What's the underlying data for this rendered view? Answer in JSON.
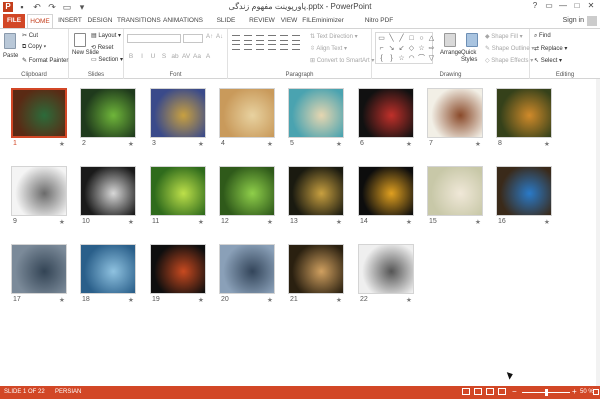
{
  "titlebar": {
    "title": "پاورپوینت مفهوم زندگی.pptx - PowerPoint",
    "app_icon_letter": "P",
    "quick_access_icons": [
      "save-icon",
      "undo-icon",
      "redo-icon",
      "present-icon",
      "customize-icon"
    ],
    "window_controls": [
      "?",
      "▭",
      "—",
      "□",
      "✕"
    ]
  },
  "tabs": [
    "FILE",
    "HOME",
    "INSERT",
    "DESIGN",
    "TRANSITIONS",
    "ANIMATIONS",
    "SLIDE SHOW",
    "REVIEW",
    "VIEW",
    "FILEminimizer",
    "Nitro PDF Professional"
  ],
  "active_tab": "HOME",
  "sign_in": "Sign in",
  "ribbon": {
    "clipboard": {
      "label": "Clipboard",
      "paste": "Paste",
      "cut": "Cut",
      "copy": "Copy",
      "format_painter": "Format Painter"
    },
    "slides": {
      "label": "Slides",
      "new_slide": "New Slide",
      "layout": "Layout",
      "reset": "Reset",
      "section": "Section"
    },
    "font": {
      "label": "Font",
      "format_buttons": [
        "B",
        "I",
        "U",
        "S",
        "ab",
        "AV",
        "Aa",
        "A"
      ]
    },
    "paragraph": {
      "label": "Paragraph",
      "text_direction": "Text Direction",
      "align_text": "Align Text",
      "convert_smartart": "Convert to SmartArt"
    },
    "drawing": {
      "label": "Drawing",
      "arrange": "Arrange",
      "quick_styles": "Quick Styles",
      "shape_fill": "Shape Fill",
      "shape_outline": "Shape Outline",
      "shape_effects": "Shape Effects",
      "shape_glyphs": [
        "▭",
        "╲",
        "╱",
        "□",
        "○",
        "△",
        "⌐",
        "↘",
        "↙",
        "◇",
        "☆",
        "⇨",
        "{",
        "}",
        "☆",
        "◠",
        "⌒",
        "▽"
      ]
    },
    "editing": {
      "label": "Editing",
      "find": "Find",
      "replace": "Replace",
      "select": "Select"
    }
  },
  "slides": [
    {
      "num": "1",
      "selected": true,
      "bg": "#5a2a14",
      "accent": "#2c6b3a"
    },
    {
      "num": "2",
      "selected": false,
      "bg": "#1f3a1c",
      "accent": "#6fb63a"
    },
    {
      "num": "3",
      "selected": false,
      "bg": "#3a4a8a",
      "accent": "#c8a040"
    },
    {
      "num": "4",
      "selected": false,
      "bg": "#c99a5b",
      "accent": "#e8d2a0"
    },
    {
      "num": "5",
      "selected": false,
      "bg": "#4aa3b0",
      "accent": "#e6d6b0"
    },
    {
      "num": "6",
      "selected": false,
      "bg": "#111111",
      "accent": "#c0302a"
    },
    {
      "num": "7",
      "selected": false,
      "bg": "#f2efe6",
      "accent": "#8a4a2a"
    },
    {
      "num": "8",
      "selected": false,
      "bg": "#35411a",
      "accent": "#d08a2a"
    },
    {
      "num": "9",
      "selected": false,
      "bg": "#f4f4f4",
      "accent": "#6b6b6b"
    },
    {
      "num": "10",
      "selected": false,
      "bg": "#1a1a1a",
      "accent": "#d8d8d8"
    },
    {
      "num": "11",
      "selected": false,
      "bg": "#2f6b1c",
      "accent": "#bde04a"
    },
    {
      "num": "12",
      "selected": false,
      "bg": "#2f5a1a",
      "accent": "#8fcf4a"
    },
    {
      "num": "13",
      "selected": false,
      "bg": "#1a1a10",
      "accent": "#c8a040"
    },
    {
      "num": "14",
      "selected": false,
      "bg": "#0d0d0d",
      "accent": "#e0a020"
    },
    {
      "num": "15",
      "selected": false,
      "bg": "#c8c8a8",
      "accent": "#f0e8d8"
    },
    {
      "num": "16",
      "selected": false,
      "bg": "#3a2a1a",
      "accent": "#2a7ac8"
    },
    {
      "num": "17",
      "selected": false,
      "bg": "#7b8a99",
      "accent": "#334455"
    },
    {
      "num": "18",
      "selected": false,
      "bg": "#2a5f8a",
      "accent": "#8fc2e0"
    },
    {
      "num": "19",
      "selected": false,
      "bg": "#0e0e0e",
      "accent": "#c84a20"
    },
    {
      "num": "20",
      "selected": false,
      "bg": "#8aa0b8",
      "accent": "#33455a"
    },
    {
      "num": "21",
      "selected": false,
      "bg": "#2a2010",
      "accent": "#d0a060"
    },
    {
      "num": "22",
      "selected": false,
      "bg": "#efefef",
      "accent": "#555555"
    }
  ],
  "star_glyph": "★",
  "status": {
    "slide_info": "SLIDE 1 OF 22",
    "language": "PERSIAN",
    "zoom_minus": "−",
    "zoom_plus": "+",
    "zoom": "50 %",
    "zoom_fraction": 0.5
  }
}
